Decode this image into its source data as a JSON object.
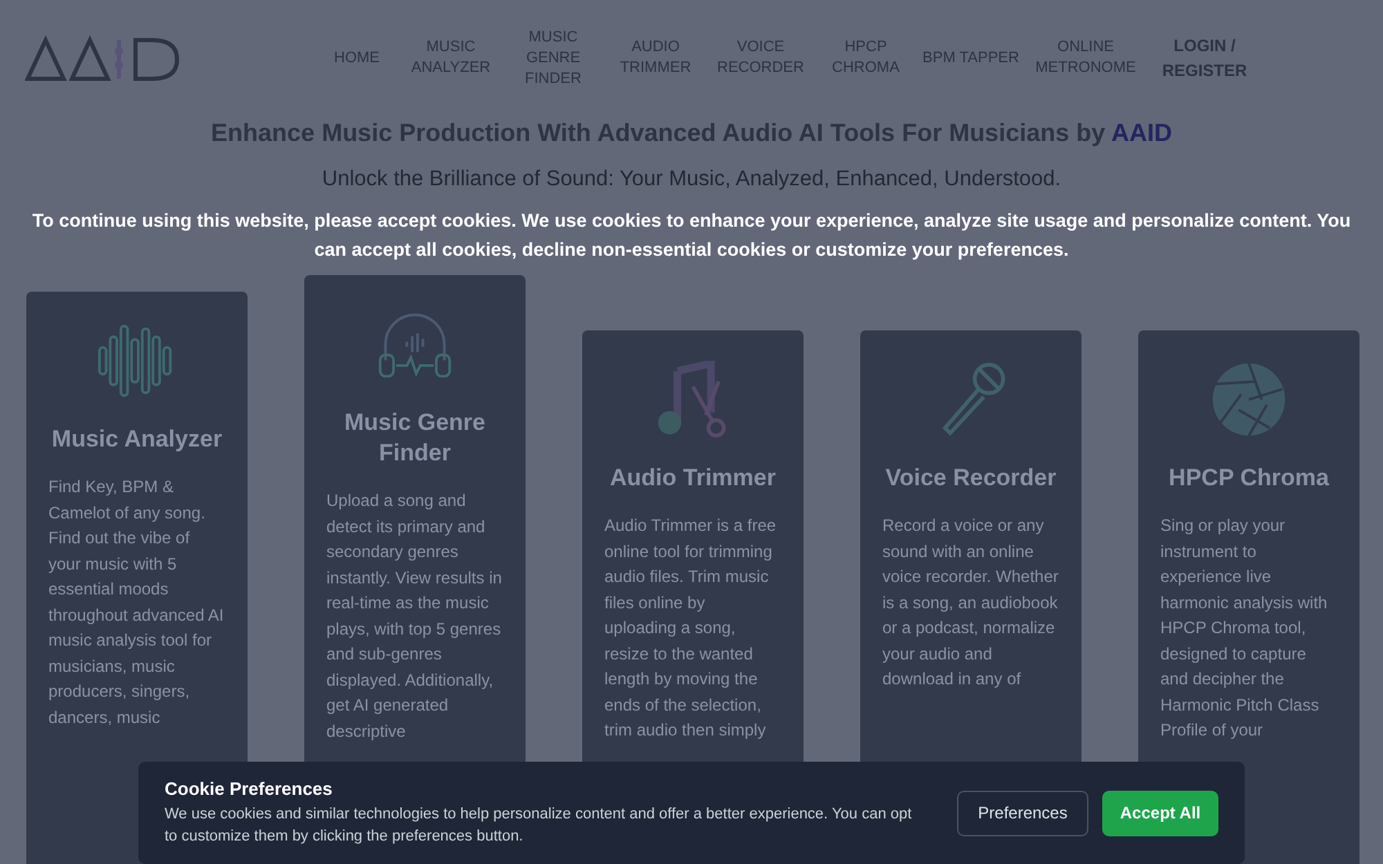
{
  "nav": {
    "items": [
      "HOME",
      "MUSIC ANALYZER",
      "MUSIC GENRE FINDER",
      "AUDIO TRIMMER",
      "VOICE RECORDER",
      "HPCP CHROMA",
      "BPM TAPPER",
      "ONLINE METRONOME"
    ],
    "login": "LOGIN / REGISTER"
  },
  "hero": {
    "title": "Enhance Music Production With Advanced Audio AI Tools For Musicians by",
    "brand": "AAID",
    "subtitle": "Unlock the Brilliance of Sound: Your Music, Analyzed, Enhanced, Understood."
  },
  "overlay_message": "To continue using this website, please accept cookies. We use cookies to enhance your experience, analyze site usage and personalize content. You can accept all cookies, decline non-essential cookies or customize your preferences.",
  "cards": [
    {
      "kind": "waveform",
      "title": "Music Analyzer",
      "description": "Find Key, BPM & Camelot of any song. Find out the vibe of your music with 5 essential moods throughout advanced AI music analysis tool for musicians, music producers, singers, dancers, music"
    },
    {
      "kind": "headphones",
      "title": "Music Genre Finder",
      "description": "Upload a song and detect its primary and secondary genres instantly. View results in real-time as the music plays, with top 5 genres and sub-genres displayed. Additionally, get AI generated descriptive"
    },
    {
      "kind": "scissors",
      "title": "Audio Trimmer",
      "description": "Audio Trimmer is a free online tool for trimming audio files. Trim music files online by uploading a song, resize to the wanted length by moving the ends of the selection, trim audio then simply"
    },
    {
      "kind": "microphone",
      "title": "Voice Recorder",
      "description": "Record a voice or any sound with an online voice recorder. Whether is a song, an audiobook or a podcast, normalize your audio and download in any of"
    },
    {
      "kind": "aperture",
      "title": "HPCP Chroma",
      "description": "Sing or play your instrument to experience live harmonic analysis with HPCP Chroma tool, designed to capture and decipher the Harmonic Pitch Class Profile of your"
    }
  ],
  "cookie_banner": {
    "title": "Cookie Preferences",
    "text": "We use cookies and similar technologies to help personalize content and offer a better experience. You can opt to customize them by clicking the preferences button.",
    "buttons": [
      {
        "label": "Preferences",
        "kind": "secondary"
      },
      {
        "label": "Accept All",
        "kind": "primary"
      }
    ]
  }
}
